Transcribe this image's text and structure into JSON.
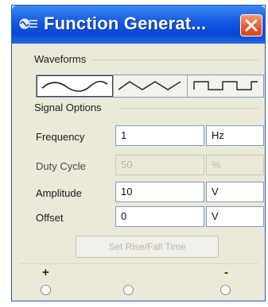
{
  "window": {
    "title": "Function Generat...",
    "close_label": "X",
    "accent_color": "#1457e0",
    "close_color": "#e2582a"
  },
  "waveforms": {
    "group_label": "Waveforms",
    "options": [
      {
        "name": "sine",
        "icon": "sine-wave-icon",
        "selected": true
      },
      {
        "name": "triangle",
        "icon": "triangle-wave-icon",
        "selected": false
      },
      {
        "name": "square",
        "icon": "square-wave-icon",
        "selected": false
      }
    ]
  },
  "signal_options": {
    "group_label": "Signal Options",
    "frequency": {
      "label": "Frequency",
      "value": "1",
      "unit": "Hz"
    },
    "duty_cycle": {
      "label": "Duty Cycle",
      "value": "50",
      "unit": "%",
      "enabled": false
    },
    "amplitude": {
      "label": "Amplitude",
      "value": "10",
      "unit": "V"
    },
    "offset": {
      "label": "Offset",
      "value": "0",
      "unit": "V"
    }
  },
  "rise_fall_button": {
    "label": "Set Rise/Fall Time",
    "enabled": false
  },
  "terminals": {
    "positive_label": "+",
    "negative_label": "-"
  }
}
